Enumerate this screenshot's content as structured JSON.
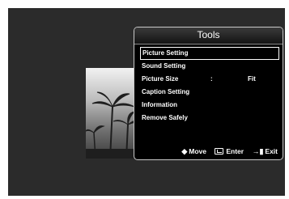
{
  "tools": {
    "title": "Tools",
    "items": [
      {
        "label": "Picture Setting",
        "separator": "",
        "value": ""
      },
      {
        "label": "Sound Setting",
        "separator": "",
        "value": ""
      },
      {
        "label": "Picture Size",
        "separator": ":",
        "value": "Fit"
      },
      {
        "label": "Caption Setting",
        "separator": "",
        "value": ""
      },
      {
        "label": "Information",
        "separator": "",
        "value": ""
      },
      {
        "label": "Remove Safely",
        "separator": "",
        "value": ""
      }
    ],
    "selected_index": 0
  },
  "footer": {
    "move_label": "Move",
    "enter_label": "Enter",
    "exit_label": "Exit",
    "move_icon": "up-down-arrow-icon",
    "enter_icon": "enter-key-icon",
    "exit_icon": "exit-door-icon"
  },
  "colors": {
    "screen_background": "#2b2b2b",
    "panel_background": "#000000",
    "text": "#ffffff"
  }
}
